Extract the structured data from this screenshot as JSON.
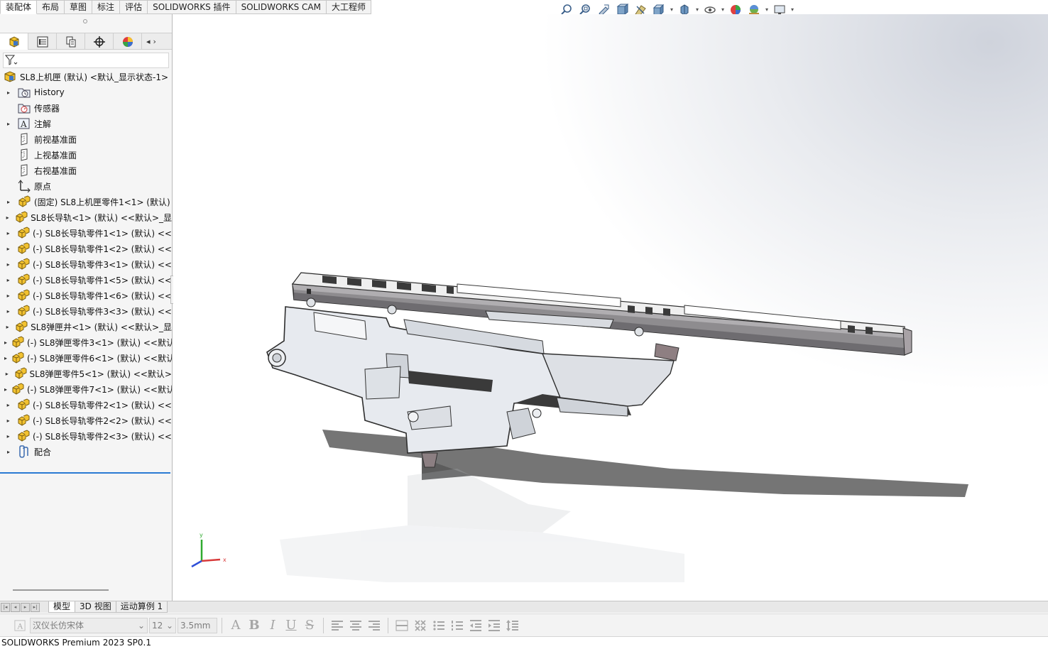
{
  "command_tabs": [
    "装配体",
    "布局",
    "草图",
    "标注",
    "评估",
    "SOLIDWORKS 插件",
    "SOLIDWORKS CAM",
    "大工程师"
  ],
  "hud_icons": [
    "zoom-to-fit-icon",
    "zoom-to-area-icon",
    "previous-view-icon",
    "section-view-icon",
    "dynamic-annotation-icon",
    "view-orientation-icon",
    "display-style-icon",
    "hide-show-items-icon",
    "edit-appearance-icon",
    "apply-scene-icon",
    "view-settings-icon"
  ],
  "manager_tabs": [
    "featuremanager-icon",
    "propertymanager-icon",
    "configurationmanager-icon",
    "dimxpertmanager-icon",
    "displaymanager-icon"
  ],
  "tree": {
    "root": "SL8上机匣 (默认) <默认_显示状态-1>",
    "items": [
      {
        "label": "History",
        "icon": "history-folder-icon",
        "expandable": true
      },
      {
        "label": "传感器",
        "icon": "sensor-icon",
        "expandable": false
      },
      {
        "label": "注解",
        "icon": "annotation-icon",
        "expandable": true
      },
      {
        "label": "前视基准面",
        "icon": "plane-icon",
        "expandable": false
      },
      {
        "label": "上视基准面",
        "icon": "plane-icon",
        "expandable": false
      },
      {
        "label": "右视基准面",
        "icon": "plane-icon",
        "expandable": false
      },
      {
        "label": "原点",
        "icon": "origin-icon",
        "expandable": false
      },
      {
        "label": "(固定) SL8上机匣零件1<1> (默认)",
        "icon": "part-icon",
        "expandable": true
      },
      {
        "label": "SL8长导轨<1> (默认) <<默认>_显",
        "icon": "part-icon",
        "expandable": true
      },
      {
        "label": "(-) SL8长导轨零件1<1> (默认) <<",
        "icon": "part-icon",
        "expandable": true
      },
      {
        "label": "(-) SL8长导轨零件1<2> (默认) <<",
        "icon": "part-icon",
        "expandable": true
      },
      {
        "label": "(-) SL8长导轨零件3<1> (默认) <<",
        "icon": "part-icon",
        "expandable": true
      },
      {
        "label": "(-) SL8长导轨零件1<5> (默认) <<",
        "icon": "part-icon",
        "expandable": true
      },
      {
        "label": "(-) SL8长导轨零件1<6> (默认) <<",
        "icon": "part-icon",
        "expandable": true
      },
      {
        "label": "(-) SL8长导轨零件3<3> (默认) <<",
        "icon": "part-icon",
        "expandable": true
      },
      {
        "label": "SL8弹匣井<1> (默认) <<默认>_显",
        "icon": "part-icon",
        "expandable": true
      },
      {
        "label": "(-) SL8弹匣零件3<1> (默认) <<默认",
        "icon": "part-icon",
        "expandable": true
      },
      {
        "label": "(-) SL8弹匣零件6<1> (默认) <<默认",
        "icon": "part-icon",
        "expandable": true
      },
      {
        "label": "SL8弹匣零件5<1> (默认) <<默认>",
        "icon": "part-icon",
        "expandable": true
      },
      {
        "label": "(-) SL8弹匣零件7<1> (默认) <<默认",
        "icon": "part-icon",
        "expandable": true
      },
      {
        "label": "(-) SL8长导轨零件2<1> (默认) <<",
        "icon": "part-icon",
        "expandable": true
      },
      {
        "label": "(-) SL8长导轨零件2<2> (默认) <<",
        "icon": "part-icon",
        "expandable": true
      },
      {
        "label": "(-) SL8长导轨零件2<3> (默认) <<",
        "icon": "part-icon",
        "expandable": true
      },
      {
        "label": "配合",
        "icon": "mates-icon",
        "expandable": true
      }
    ]
  },
  "triad": {
    "x": "x",
    "y": "y"
  },
  "bottom_tabs": [
    "模型",
    "3D 视图",
    "运动算例 1"
  ],
  "format_bar": {
    "font": "汉仪长仿宋体",
    "size": "12",
    "height": "3.5mm",
    "buttons": [
      "font-color-icon",
      "bold-icon",
      "italic-icon",
      "underline-icon",
      "strikethrough-icon",
      "align-left-icon",
      "align-center-icon",
      "align-right-icon",
      "stack-icon",
      "symbol-icon",
      "bullets-icon",
      "numbering-icon",
      "decrease-indent-icon",
      "increase-indent-icon",
      "line-spacing-icon"
    ]
  },
  "status": "SOLIDWORKS Premium 2023 SP0.1",
  "colors": {
    "accent": "#2a7ad3",
    "part_yellow": "#f2c230",
    "model_body": "#e6e9ee",
    "rail": "#8c8a8d"
  }
}
